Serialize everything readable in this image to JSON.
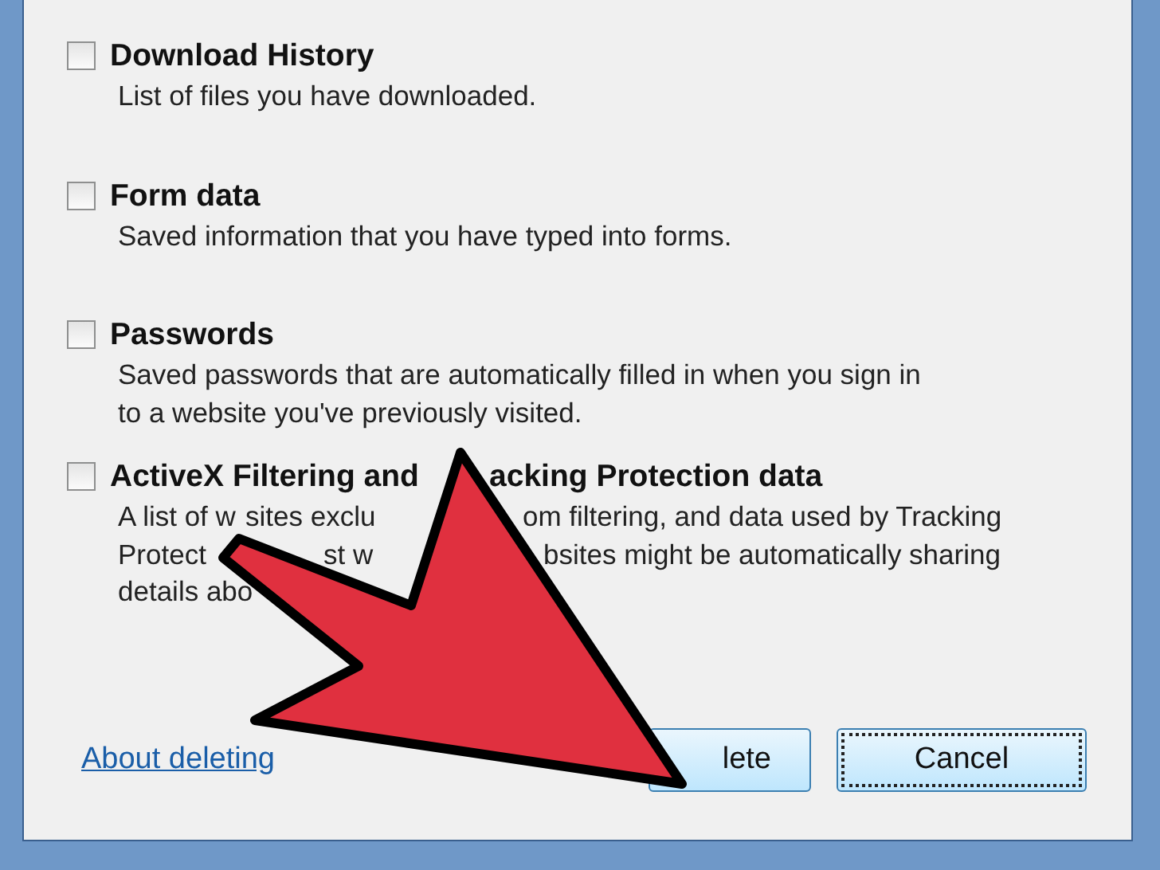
{
  "options": [
    {
      "checked": false,
      "title": [
        "Download History"
      ],
      "description": [
        [
          "List of files you have downloaded."
        ]
      ]
    },
    {
      "checked": false,
      "title": [
        "Form data"
      ],
      "description": [
        [
          "Saved information that you have typed into forms."
        ]
      ]
    },
    {
      "checked": false,
      "title": [
        "Passwords"
      ],
      "description": [
        [
          "Saved passwords that are automatically filled in when you sign in"
        ],
        [
          "to a website you've previously visited."
        ]
      ]
    },
    {
      "checked": false,
      "title": [
        "ActiveX Filtering and",
        "acking Protection data"
      ],
      "description": [
        [
          "A list of w",
          "sites exclu",
          "om filtering, and data used by Tracking"
        ],
        [
          "Protect",
          "st w",
          "bsites might be automatically sharing"
        ],
        [
          "details abo"
        ]
      ]
    }
  ],
  "link": "About deleting",
  "buttons": [
    {
      "label": "lete",
      "focused": false
    },
    {
      "label": "Cancel",
      "focused": true
    }
  ]
}
